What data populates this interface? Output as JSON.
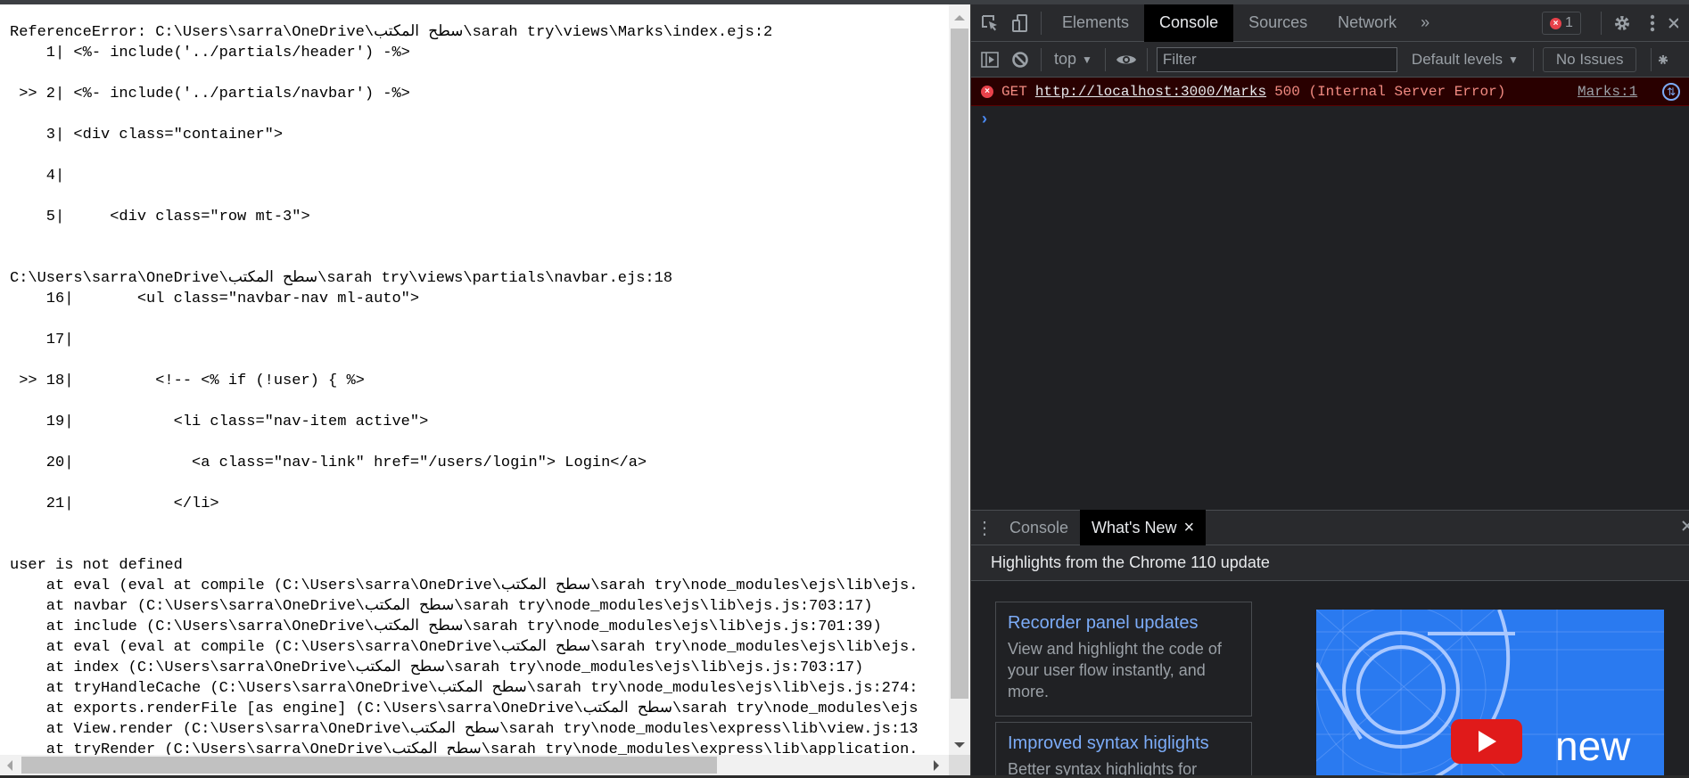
{
  "error_page": {
    "lines": [
      {
        "text": "ReferenceError: C:\\Users\\sarra\\OneDrive\\سطح المكتب\\sarah try\\views\\Marks\\index.ejs:2"
      },
      {
        "text": "    1| <%- include('../partials/header') -%>"
      },
      {
        "text": ""
      },
      {
        "text": " >> 2| <%- include('../partials/navbar') -%>"
      },
      {
        "text": ""
      },
      {
        "text": "    3| <div class=\"container\">"
      },
      {
        "text": ""
      },
      {
        "text": "    4| "
      },
      {
        "text": ""
      },
      {
        "text": "    5|     <div class=\"row mt-3\">"
      },
      {
        "text": ""
      },
      {
        "text": ""
      },
      {
        "text": "C:\\Users\\sarra\\OneDrive\\سطح المكتب\\sarah try\\views\\partials\\navbar.ejs:18"
      },
      {
        "text": "    16|       <ul class=\"navbar-nav ml-auto\">"
      },
      {
        "text": ""
      },
      {
        "text": "    17| "
      },
      {
        "text": ""
      },
      {
        "text": " >> 18|         <!-- <% if (!user) { %>"
      },
      {
        "text": ""
      },
      {
        "text": "    19|           <li class=\"nav-item active\">"
      },
      {
        "text": ""
      },
      {
        "text": "    20|             <a class=\"nav-link\" href=\"/users/login\"> Login</a>"
      },
      {
        "text": ""
      },
      {
        "text": "    21|           </li>"
      },
      {
        "text": ""
      },
      {
        "text": ""
      },
      {
        "text": "user is not defined"
      },
      {
        "text": "    at eval (eval at compile (C:\\Users\\sarra\\OneDrive\\سطح المكتب\\sarah try\\node_modules\\ejs\\lib\\ejs."
      },
      {
        "text": "    at navbar (C:\\Users\\sarra\\OneDrive\\سطح المكتب\\sarah try\\node_modules\\ejs\\lib\\ejs.js:703:17)"
      },
      {
        "text": "    at include (C:\\Users\\sarra\\OneDrive\\سطح المكتب\\sarah try\\node_modules\\ejs\\lib\\ejs.js:701:39)"
      },
      {
        "text": "    at eval (eval at compile (C:\\Users\\sarra\\OneDrive\\سطح المكتب\\sarah try\\node_modules\\ejs\\lib\\ejs."
      },
      {
        "text": "    at index (C:\\Users\\sarra\\OneDrive\\سطح المكتب\\sarah try\\node_modules\\ejs\\lib\\ejs.js:703:17)"
      },
      {
        "text": "    at tryHandleCache (C:\\Users\\sarra\\OneDrive\\سطح المكتب\\sarah try\\node_modules\\ejs\\lib\\ejs.js:274:"
      },
      {
        "text": "    at exports.renderFile [as engine] (C:\\Users\\sarra\\OneDrive\\سطح المكتب\\sarah try\\node_modules\\ejs"
      },
      {
        "text": "    at View.render (C:\\Users\\sarra\\OneDrive\\سطح المكتب\\sarah try\\node_modules\\express\\lib\\view.js:13"
      },
      {
        "text": "    at tryRender (C:\\Users\\sarra\\OneDrive\\سطح المكتب\\sarah try\\node_modules\\express\\lib\\application."
      }
    ]
  },
  "devtools": {
    "main_tabs": [
      {
        "label": "Elements",
        "active": false
      },
      {
        "label": "Console",
        "active": true
      },
      {
        "label": "Sources",
        "active": false
      },
      {
        "label": "Network",
        "active": false
      }
    ],
    "more_tabs_glyph": "»",
    "error_count": "1",
    "toolbar": {
      "context": "top",
      "filter_placeholder": "Filter",
      "levels": "Default levels",
      "issues": "No Issues"
    },
    "console": {
      "method": "GET",
      "url": "http://localhost:3000/Marks",
      "status": "500 (Internal Server Error)",
      "source": "Marks:1",
      "prompt": "›"
    },
    "drawer": {
      "tabs": [
        {
          "label": "Console",
          "active": false
        },
        {
          "label": "What's New",
          "active": true
        }
      ],
      "close_glyph": "×",
      "highlights_title": "Highlights from the Chrome 110 update",
      "cards": [
        {
          "title": "Recorder panel updates",
          "description": "View and highlight the code of your user flow instantly, and more."
        },
        {
          "title": "Improved syntax higlights",
          "description": "Better syntax highlights for"
        }
      ],
      "video_caption": "new"
    }
  },
  "colors": {
    "error_red": "#e8424b",
    "error_bg": "#290000",
    "error_text": "#f28b82",
    "link_blue": "#7cacf8",
    "video_blue": "#2a7af0"
  }
}
